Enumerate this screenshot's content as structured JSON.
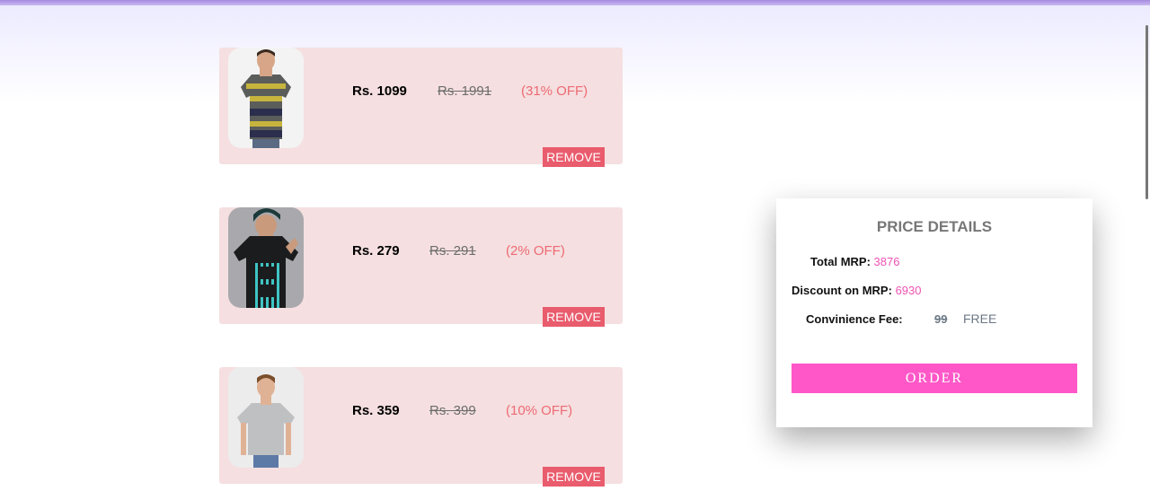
{
  "cart": {
    "items": [
      {
        "price": "Rs. 1099",
        "mrp": "Rs. 1991",
        "off": "(31% OFF)",
        "remove_label": "REMOVE",
        "image": "striped-polo-shirt"
      },
      {
        "price": "Rs. 279",
        "mrp": "Rs. 291",
        "off": "(2% OFF)",
        "remove_label": "REMOVE",
        "image": "black-graphic-tshirt"
      },
      {
        "price": "Rs. 359",
        "mrp": "Rs. 399",
        "off": "(10% OFF)",
        "remove_label": "REMOVE",
        "image": "grey-plain-tshirt"
      }
    ]
  },
  "price_details": {
    "title": "PRICE DETAILS",
    "total_mrp_label": "Total MRP:",
    "total_mrp_value": "3876",
    "discount_label": "Discount on MRP:",
    "discount_value": "6930",
    "fee_label": "Convinience Fee:",
    "fee_strike": "99",
    "fee_free": "FREE",
    "order_label": "ORDER"
  },
  "colors": {
    "card_bg": "#f5dfe0",
    "remove_bg": "#e95c6d",
    "discount_text": "#ee6a73",
    "accent_pink": "#f052b4",
    "order_bg": "#ff57c8"
  }
}
